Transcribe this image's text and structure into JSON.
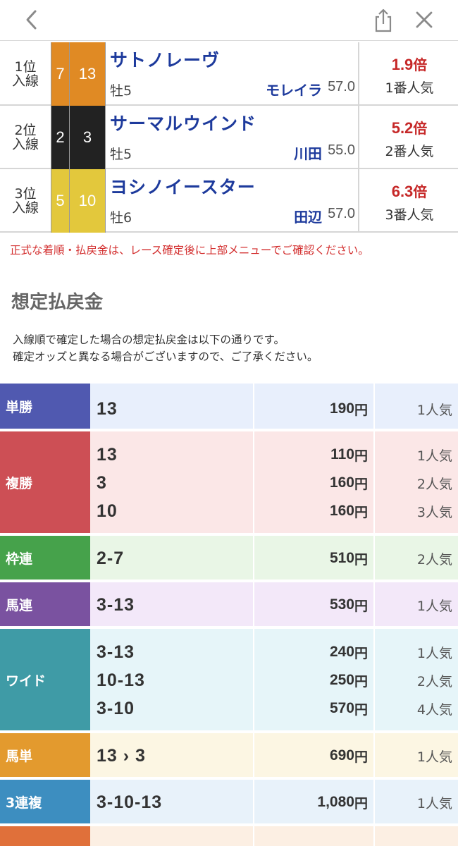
{
  "header": {
    "back_icon": "chevron-left-icon",
    "share_icon": "share-icon",
    "close_icon": "close-icon"
  },
  "results": [
    {
      "rank": "1位",
      "rank_sub": "入線",
      "waku": "7",
      "umaban": "13",
      "waku_color": "#e08a24",
      "waku_text_color": "#ffffff",
      "name": "サトノレーヴ",
      "sex_age": "牡5",
      "jockey": "モレイラ",
      "weight": "57.0",
      "odds": "1.9",
      "odds_unit": "倍",
      "popularity": "1番人気"
    },
    {
      "rank": "2位",
      "rank_sub": "入線",
      "waku": "2",
      "umaban": "3",
      "waku_color": "#222222",
      "waku_text_color": "#ffffff",
      "name": "サーマルウインド",
      "sex_age": "牡5",
      "jockey": "川田",
      "weight": "55.0",
      "odds": "5.2",
      "odds_unit": "倍",
      "popularity": "2番人気"
    },
    {
      "rank": "3位",
      "rank_sub": "入線",
      "waku": "5",
      "umaban": "10",
      "waku_color": "#e3c83c",
      "waku_text_color": "#ffffff",
      "name": "ヨシノイースター",
      "sex_age": "牡6",
      "jockey": "田辺",
      "weight": "57.0",
      "odds": "6.3",
      "odds_unit": "倍",
      "popularity": "3番人気"
    }
  ],
  "notice": "正式な着順・払戻金は、レース確定後に上部メニューでご確認ください。",
  "payout_section": {
    "title": "想定払戻金",
    "desc_line1": "入線順で確定した場合の想定払戻金は以下の通りです。",
    "desc_line2": "確定オッズと異なる場合がございますので、ご了承ください。",
    "yen": "円",
    "rows": [
      {
        "type": "単勝",
        "color": "#5059b0",
        "bg": "#e8effc",
        "items": [
          {
            "combo": "13",
            "amount": "190",
            "pop": "1人気"
          }
        ]
      },
      {
        "type": "複勝",
        "color": "#cd4f55",
        "bg": "#fbe7e7",
        "items": [
          {
            "combo": "13",
            "amount": "110",
            "pop": "1人気"
          },
          {
            "combo": "3",
            "amount": "160",
            "pop": "2人気"
          },
          {
            "combo": "10",
            "amount": "160",
            "pop": "3人気"
          }
        ]
      },
      {
        "type": "枠連",
        "color": "#46a24b",
        "bg": "#e9f6e6",
        "items": [
          {
            "combo": "2-7",
            "amount": "510",
            "pop": "2人気"
          }
        ]
      },
      {
        "type": "馬連",
        "color": "#7a52a0",
        "bg": "#f3e8f9",
        "items": [
          {
            "combo": "3-13",
            "amount": "530",
            "pop": "1人気"
          }
        ]
      },
      {
        "type": "ワイド",
        "color": "#3f9ba6",
        "bg": "#e6f5f9",
        "items": [
          {
            "combo": "3-13",
            "amount": "240",
            "pop": "1人気"
          },
          {
            "combo": "10-13",
            "amount": "250",
            "pop": "2人気"
          },
          {
            "combo": "3-10",
            "amount": "570",
            "pop": "4人気"
          }
        ]
      },
      {
        "type": "馬単",
        "color": "#e39a2e",
        "bg": "#fcf6e3",
        "items": [
          {
            "combo": "13 › 3",
            "amount": "690",
            "pop": "1人気"
          }
        ]
      },
      {
        "type": "3連複",
        "color": "#3d8ec0",
        "bg": "#e8f2fa",
        "items": [
          {
            "combo": "3-10-13",
            "amount": "1,080",
            "pop": "1人気"
          }
        ]
      },
      {
        "type": "",
        "color": "#e0703a",
        "bg": "#fcefe3",
        "items": []
      }
    ]
  }
}
